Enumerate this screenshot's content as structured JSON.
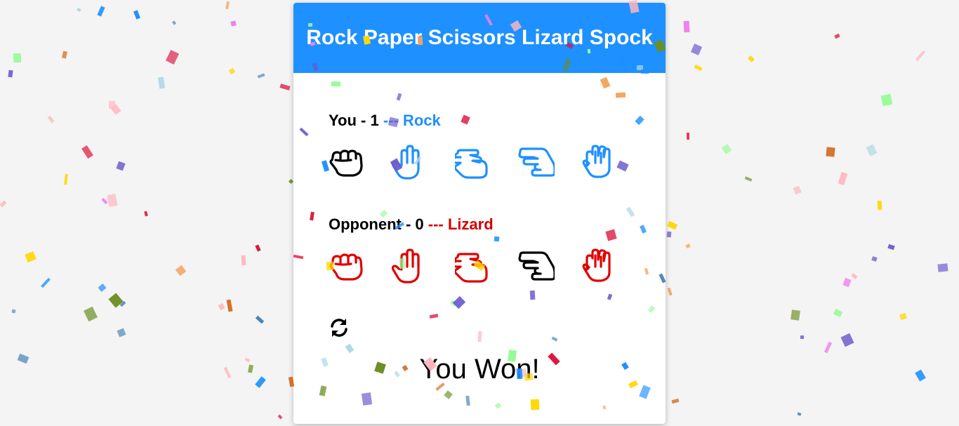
{
  "title": "Rock Paper Scissors Lizard Spock",
  "player": {
    "label": "You - 1",
    "choice_text": "--- Rock",
    "selected": "rock",
    "hands": [
      "rock",
      "paper",
      "scissors",
      "lizard",
      "spock"
    ]
  },
  "opponent": {
    "label": "Opponent - 0",
    "choice_text": "--- Lizard",
    "selected": "lizard",
    "hands": [
      "rock",
      "paper",
      "scissors",
      "lizard",
      "spock"
    ]
  },
  "reset_icon": "refresh-icon",
  "result": "You Won!",
  "colors": {
    "header": "#1e90ff",
    "player_accent": "#1e90ff",
    "opponent_accent": "#d50000",
    "confetti": [
      "#dc143c",
      "#ffd700",
      "#1e90ff",
      "#98fb98",
      "#ee82ee",
      "#ffb6c1",
      "#add8e6",
      "#d2691e",
      "#6b8e23",
      "#6a5acd",
      "#4682b4",
      "#f4a460"
    ]
  }
}
